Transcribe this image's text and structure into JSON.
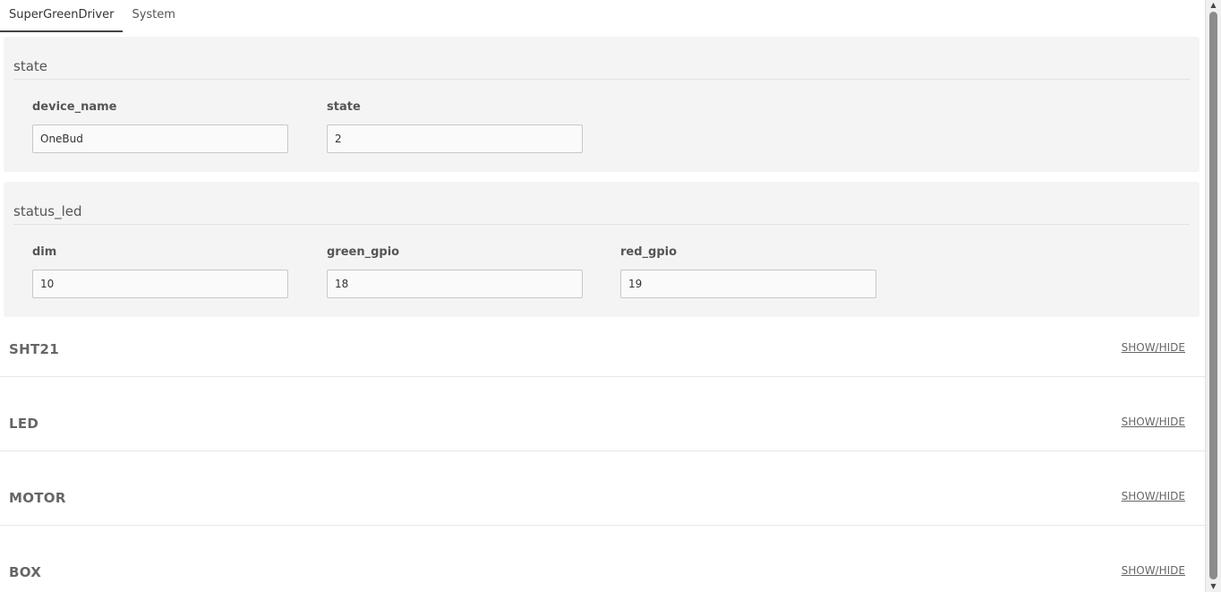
{
  "tabs": [
    {
      "label": "SuperGreenDriver",
      "active": true
    },
    {
      "label": "System",
      "active": false
    }
  ],
  "panels": {
    "state": {
      "title": "state",
      "fields": [
        {
          "label": "device_name",
          "value": "OneBud"
        },
        {
          "label": "state",
          "value": "2"
        }
      ]
    },
    "status_led": {
      "title": "status_led",
      "fields": [
        {
          "label": "dim",
          "value": "10"
        },
        {
          "label": "green_gpio",
          "value": "18"
        },
        {
          "label": "red_gpio",
          "value": "19"
        }
      ]
    }
  },
  "sections": [
    {
      "title": "SHT21",
      "toggle": "SHOW/HIDE"
    },
    {
      "title": "LED",
      "toggle": "SHOW/HIDE"
    },
    {
      "title": "MOTOR",
      "toggle": "SHOW/HIDE"
    },
    {
      "title": "BOX",
      "toggle": "SHOW/HIDE"
    }
  ],
  "scrollbar": {
    "up_icon": "triangle-up",
    "down_icon": "triangle-down"
  }
}
